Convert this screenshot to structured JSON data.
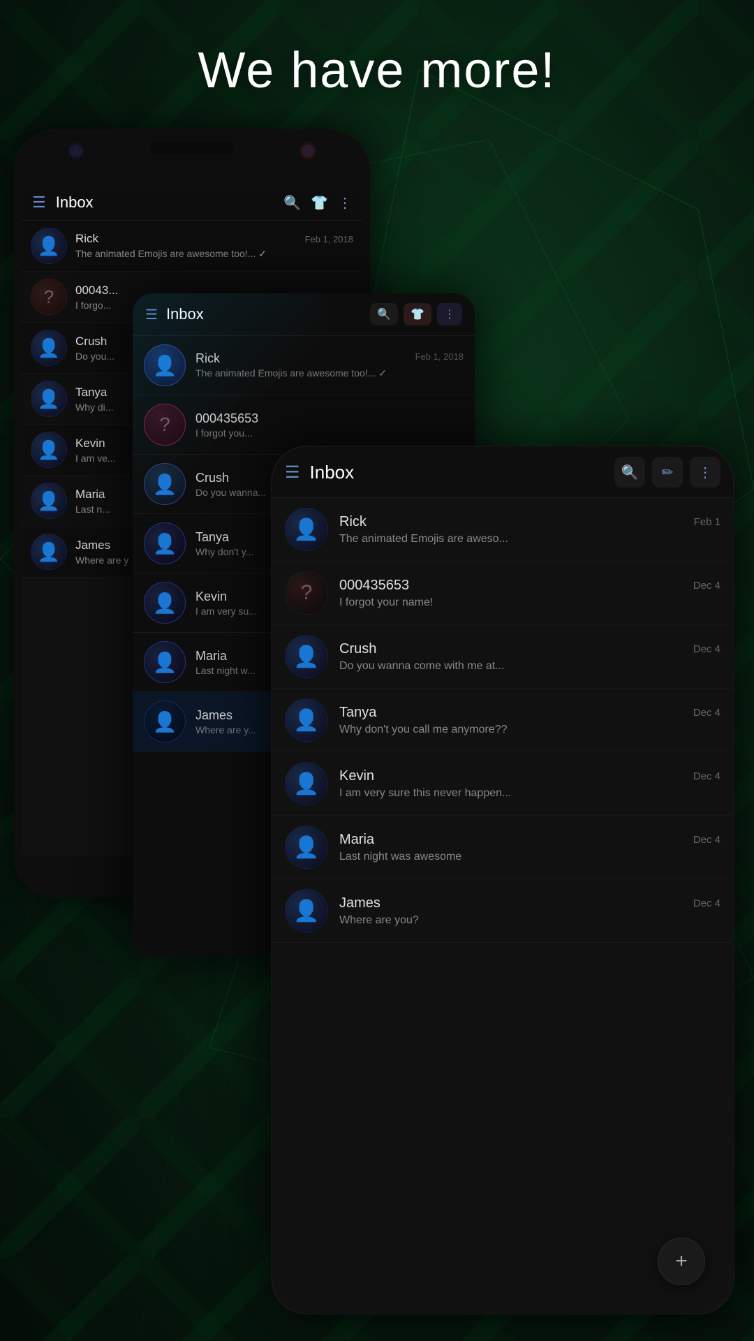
{
  "page": {
    "title": "We have more!"
  },
  "back_phone": {
    "inbox_title": "Inbox",
    "messages": [
      {
        "name": "Rick",
        "preview": "The animated Emojis are awesome too!...",
        "date": "Feb 1, 2018",
        "has_check": true,
        "avatar_type": "person"
      },
      {
        "name": "00043...",
        "preview": "I forgo...",
        "date": "",
        "avatar_type": "unknown"
      },
      {
        "name": "Crush",
        "preview": "Do you...",
        "date": "",
        "avatar_type": "person"
      },
      {
        "name": "Tanya",
        "preview": "Why di...",
        "date": "",
        "avatar_type": "person"
      },
      {
        "name": "Kevin",
        "preview": "I am ve...",
        "date": "",
        "avatar_type": "person"
      },
      {
        "name": "Maria",
        "preview": "Last n...",
        "date": "",
        "avatar_type": "person"
      },
      {
        "name": "James",
        "preview": "Where are y",
        "date": "",
        "avatar_type": "person"
      }
    ]
  },
  "mid_phone": {
    "inbox_title": "Inbox",
    "messages": [
      {
        "name": "Rick",
        "preview": "The animated Emojis are awesome too!...",
        "date": "Feb 1, 2018",
        "has_check": true,
        "avatar_type": "rick"
      },
      {
        "name": "000435653",
        "preview": "I forgot you...",
        "date": "",
        "avatar_type": "unknown-mid"
      },
      {
        "name": "Crush",
        "preview": "Do you wanna...",
        "date": "",
        "avatar_type": "crush"
      },
      {
        "name": "Tanya",
        "preview": "Why don't y...",
        "date": "",
        "avatar_type": "person"
      },
      {
        "name": "Kevin",
        "preview": "I am very su...",
        "date": "",
        "avatar_type": "person"
      },
      {
        "name": "Maria",
        "preview": "Last night w...",
        "date": "",
        "avatar_type": "person"
      },
      {
        "name": "James",
        "preview": "Where are y...",
        "date": "",
        "avatar_type": "james",
        "highlighted": true
      }
    ]
  },
  "front_phone": {
    "inbox_title": "Inbox",
    "messages": [
      {
        "name": "Rick",
        "preview": "The animated Emojis are aweso...",
        "date": "Feb 1",
        "avatar_type": "person"
      },
      {
        "name": "000435653",
        "preview": "I forgot your name!",
        "date": "Dec 4",
        "avatar_type": "unknown"
      },
      {
        "name": "Crush",
        "preview": "Do you wanna come with me at...",
        "date": "Dec 4",
        "avatar_type": "person"
      },
      {
        "name": "Tanya",
        "preview": "Why don't you call me anymore??",
        "date": "Dec 4",
        "avatar_type": "person"
      },
      {
        "name": "Kevin",
        "preview": "I am very sure this never happen...",
        "date": "Dec 4",
        "avatar_type": "person"
      },
      {
        "name": "Maria",
        "preview": "Last night was awesome",
        "date": "Dec 4",
        "avatar_type": "person"
      },
      {
        "name": "James",
        "preview": "Where are you?",
        "date": "Dec 4",
        "avatar_type": "person"
      }
    ],
    "fab_icon": "+"
  },
  "icons": {
    "menu": "☰",
    "search": "🔍",
    "more": "⋮",
    "shirt": "👕",
    "person": "👤",
    "edit": "✏",
    "plus": "+"
  }
}
